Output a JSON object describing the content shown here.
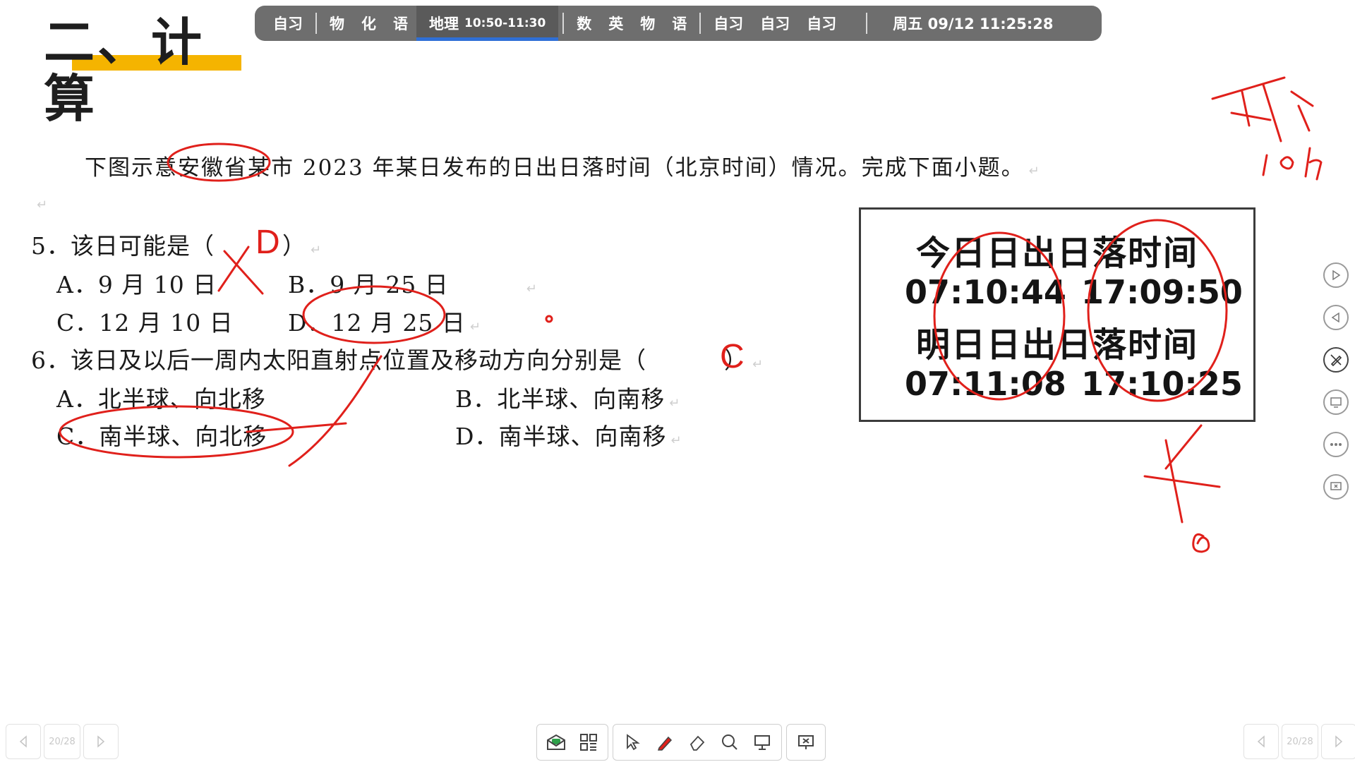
{
  "heading": {
    "text": "二、计算"
  },
  "schedule": {
    "periods": [
      {
        "label": "自习"
      },
      {
        "label": "物"
      },
      {
        "label": "化"
      },
      {
        "label": "语"
      }
    ],
    "current": {
      "label": "地理",
      "time": "10:50-11:30"
    },
    "after": [
      "数",
      "英",
      "物",
      "语"
    ],
    "self_study": [
      "自习",
      "自习",
      "自习"
    ],
    "clock": "周五 09/12  11:25:28"
  },
  "document": {
    "intro": "下图示意安徽省某市 2023 年某日发布的日出日落时间（北京时间）情况。完成下面小题。",
    "q5": {
      "stem": "5．该日可能是（",
      "close": "）",
      "options": {
        "a": "A．9 月 10 日",
        "b": "B．9 月 25 日",
        "c": "C．12 月 10 日",
        "d": "D．12 月 25 日"
      }
    },
    "q6": {
      "stem": "6．该日及以后一周内太阳直射点位置及移动方向分别是（",
      "close": "）",
      "options": {
        "a": "A．北半球、向北移",
        "b": "B．北半球、向南移",
        "c": "C．南半球、向北移",
        "d": "D．南半球、向南移"
      }
    },
    "para_mark": "↵"
  },
  "annotations": {
    "q5_answer": "D",
    "q6_answer": "C"
  },
  "sun_table": {
    "today_title": "今日日出日落时间",
    "today_sunrise": "07:10:44",
    "today_sunset": "17:09:50",
    "tomorrow_title": "明日日出日落时间",
    "tomorrow_sunrise": "07:11:08",
    "tomorrow_sunset": "17:10:25"
  },
  "pager": {
    "left": "20/28",
    "right": "20/28"
  },
  "toolbar": {
    "icons": [
      "envelope-icon",
      "qr-grid-icon",
      "cursor-icon",
      "pen-icon",
      "eraser-icon",
      "search-icon",
      "screen-icon",
      "close-screen-icon"
    ]
  },
  "colors": {
    "ink": "#e0201b",
    "accent_bar": "#f5b400",
    "schedule_bg": "#6e6e6e",
    "highlight": "#2f6fd6"
  }
}
